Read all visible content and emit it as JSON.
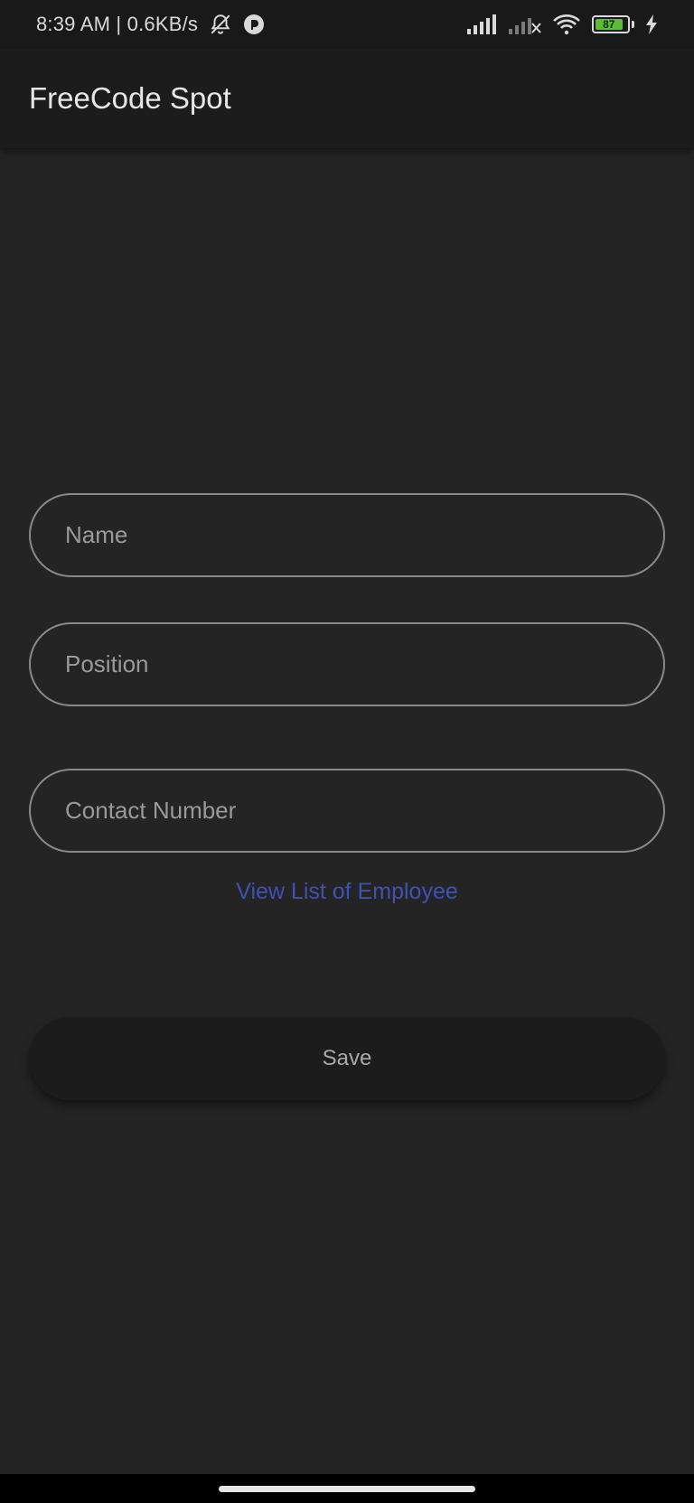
{
  "status_bar": {
    "time_speed": "8:39 AM | 0.6KB/s",
    "battery_level": "87",
    "icons": [
      "notifications-off-icon",
      "app-indicator-icon",
      "signal-icon",
      "signal-no-sim-icon",
      "wifi-icon",
      "battery-icon",
      "charging-icon"
    ]
  },
  "app_bar": {
    "title": "FreeCode Spot"
  },
  "form": {
    "name_placeholder": "Name",
    "position_placeholder": "Position",
    "contact_placeholder": "Contact Number",
    "view_list_label": "View List of Employee",
    "save_label": "Save"
  },
  "colors": {
    "background": "#242424",
    "app_bar": "#1c1c1c",
    "link": "#3f51b5",
    "battery": "#5bbd2f"
  }
}
